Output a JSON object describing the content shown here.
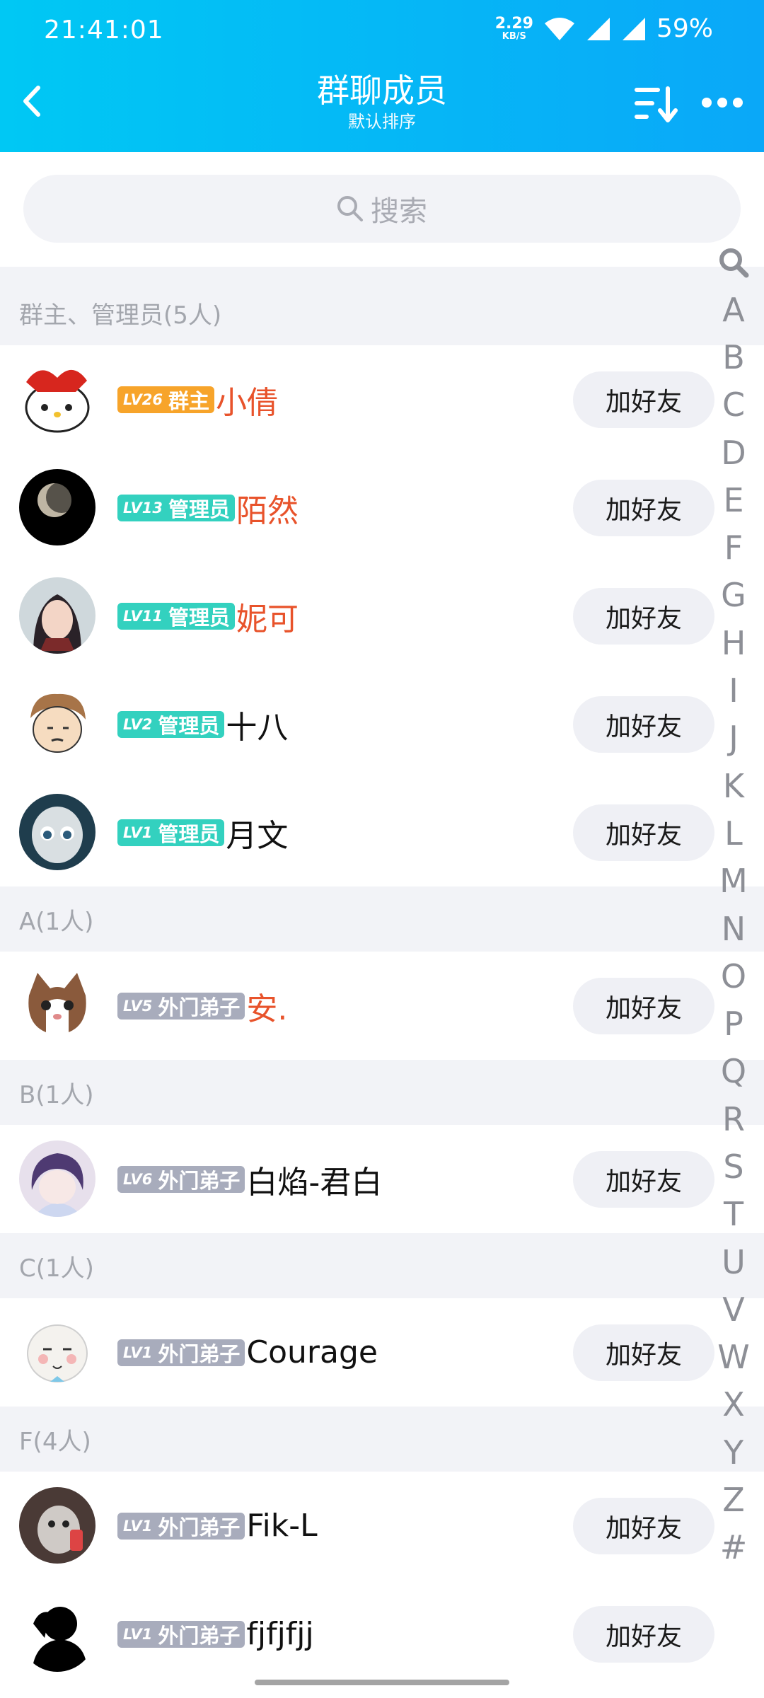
{
  "status_bar": {
    "time": "21:41:01",
    "net_speed": "2.29",
    "net_unit": "KB/S",
    "battery": "59%"
  },
  "header": {
    "title": "群聊成员",
    "subtitle": "默认排序"
  },
  "search": {
    "placeholder": "搜索"
  },
  "colors": {
    "header_gradient_start": "#00c8f4",
    "header_gradient_end": "#0aa8f8",
    "owner_badge": "#f7a42a",
    "admin_badge": "#33d1bf",
    "member_badge": "#a8acbc",
    "highlight_name": "#e8532b",
    "normal_name": "#111111"
  },
  "sections": [
    {
      "title": "群主、管理员(5人)",
      "members": [
        {
          "level": "LV26",
          "role": "群主",
          "name": "小倩",
          "badge_type": "owner",
          "name_color": "#e8532b",
          "avatar": "hello-kitty-avatar",
          "button": "加好友"
        },
        {
          "level": "LV13",
          "role": "管理员",
          "name": "陌然",
          "badge_type": "admin",
          "name_color": "#e8532b",
          "avatar": "moon-avatar",
          "button": "加好友"
        },
        {
          "level": "LV11",
          "role": "管理员",
          "name": "妮可",
          "badge_type": "admin",
          "name_color": "#e8532b",
          "avatar": "anime-girl-avatar",
          "button": "加好友"
        },
        {
          "level": "LV2",
          "role": "管理员",
          "name": "十八",
          "badge_type": "admin",
          "name_color": "#111111",
          "avatar": "cartoon-boy-avatar",
          "button": "加好友"
        },
        {
          "level": "LV1",
          "role": "管理员",
          "name": "月文",
          "badge_type": "admin",
          "name_color": "#111111",
          "avatar": "doll-face-avatar",
          "button": "加好友"
        }
      ]
    },
    {
      "title": "A(1人)",
      "members": [
        {
          "level": "LV5",
          "role": "外门弟子",
          "name": "安.",
          "badge_type": "member",
          "name_color": "#e8532b",
          "avatar": "cat-avatar",
          "button": "加好友"
        }
      ]
    },
    {
      "title": "B(1人)",
      "members": [
        {
          "level": "LV6",
          "role": "外门弟子",
          "name": "白焰-君白",
          "badge_type": "member",
          "name_color": "#111111",
          "avatar": "anime-boy-avatar",
          "button": "加好友"
        }
      ]
    },
    {
      "title": "C(1人)",
      "members": [
        {
          "level": "LV1",
          "role": "外门弟子",
          "name": "Courage",
          "badge_type": "member",
          "name_color": "#111111",
          "avatar": "meme-face-avatar",
          "button": "加好友"
        }
      ]
    },
    {
      "title": "F(4人)",
      "members": [
        {
          "level": "LV1",
          "role": "外门弟子",
          "name": "Fik-L",
          "badge_type": "member",
          "name_color": "#111111",
          "avatar": "pet-photo-avatar",
          "button": "加好友"
        },
        {
          "level": "LV1",
          "role": "外门弟子",
          "name": "fjfjfjj",
          "badge_type": "member",
          "name_color": "#111111",
          "avatar": "silhouette-avatar",
          "button": "加好友"
        }
      ]
    }
  ],
  "index_bar": [
    "A",
    "B",
    "C",
    "D",
    "E",
    "F",
    "G",
    "H",
    "I",
    "J",
    "K",
    "L",
    "M",
    "N",
    "O",
    "P",
    "Q",
    "R",
    "S",
    "T",
    "U",
    "V",
    "W",
    "X",
    "Y",
    "Z",
    "#"
  ]
}
